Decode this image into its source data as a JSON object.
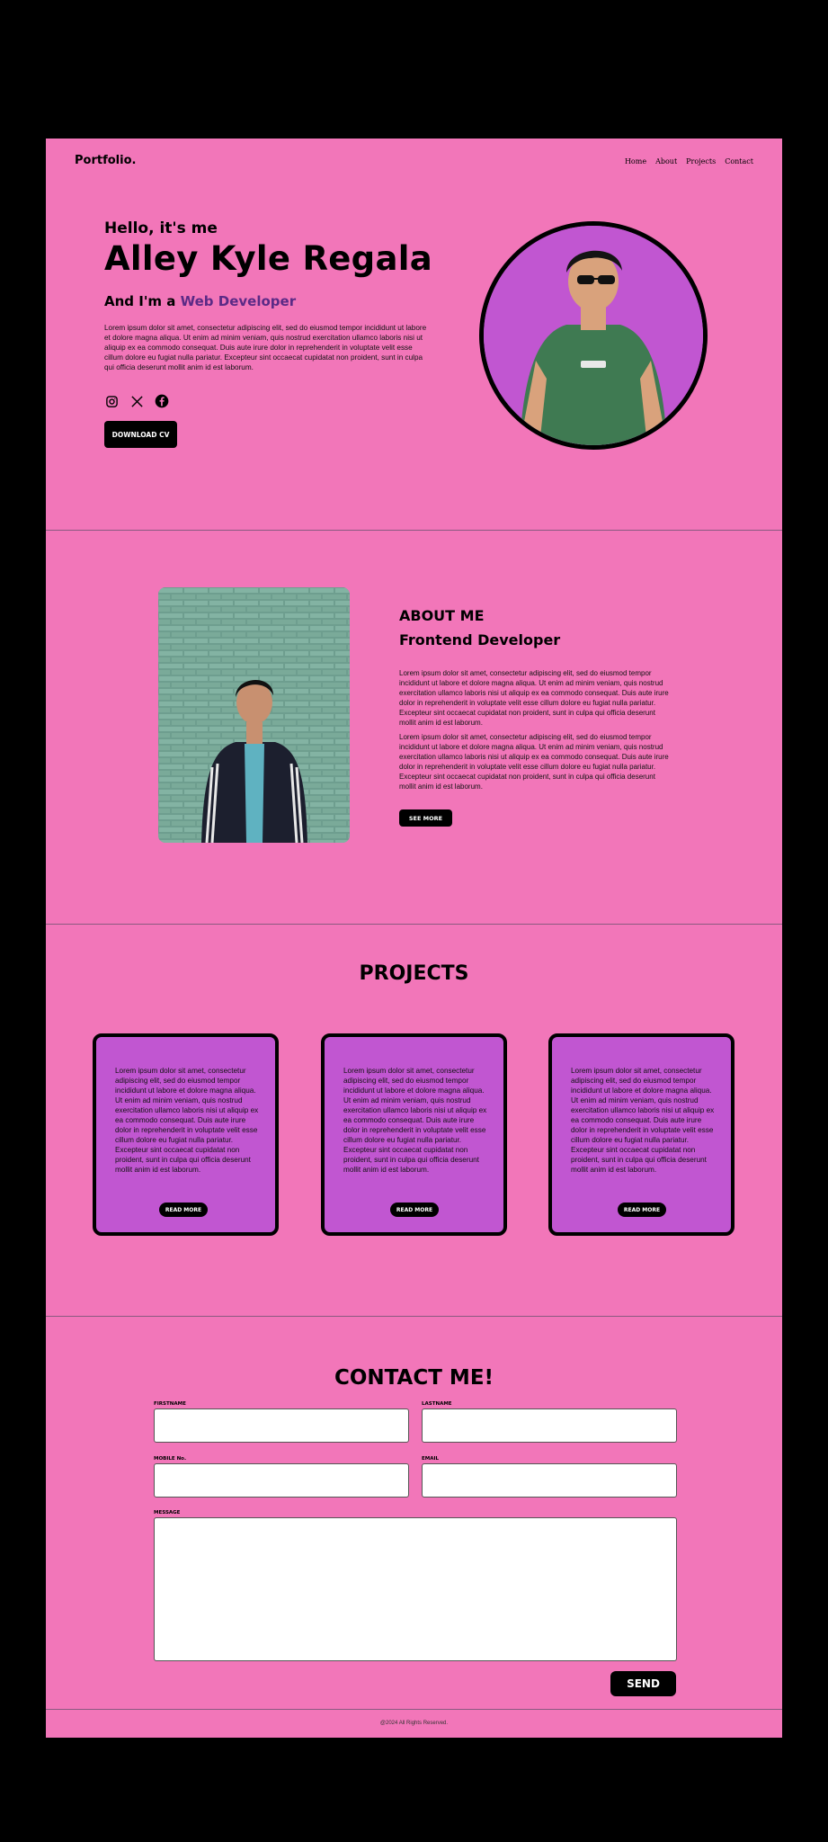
{
  "nav": {
    "logo": "Portfolio.",
    "links": [
      "Home",
      "About",
      "Projects",
      "Contact"
    ]
  },
  "hero": {
    "greeting": "Hello, it's me",
    "name": "Alley Kyle Regala",
    "role_prefix": "And I'm a ",
    "role_highlight": "Web Developer",
    "description": "Lorem ipsum dolor sit amet, consectetur adipiscing elit, sed do eiusmod tempor incididunt ut labore et dolore magna aliqua. Ut enim ad minim veniam, quis nostrud exercitation ullamco laboris nisi ut aliquip ex ea commodo consequat. Duis aute irure dolor in reprehenderit in voluptate velit esse cillum dolore eu fugiat nulla pariatur. Excepteur sint occaecat cupidatat non proident, sunt in culpa qui officia deserunt mollit anim id est laborum.",
    "social_icons": [
      "instagram-icon",
      "x-icon",
      "facebook-icon"
    ],
    "download_label": "DOWNLOAD CV"
  },
  "about": {
    "title": "ABOUT ME",
    "subtitle": "Frontend Developer",
    "paragraph1": "Lorem ipsum dolor sit amet, consectetur adipiscing elit, sed do eiusmod tempor incididunt ut labore et dolore magna aliqua. Ut enim ad minim veniam, quis nostrud exercitation ullamco laboris nisi ut aliquip ex ea commodo consequat. Duis aute irure dolor in reprehenderit in voluptate velit esse cillum dolore eu fugiat nulla pariatur. Excepteur sint occaecat cupidatat non proident, sunt in culpa qui officia deserunt mollit anim id est laborum.",
    "paragraph2": "Lorem ipsum dolor sit amet, consectetur adipiscing elit, sed do eiusmod tempor incididunt ut labore et dolore magna aliqua. Ut enim ad minim veniam, quis nostrud exercitation ullamco laboris nisi ut aliquip ex ea commodo consequat. Duis aute irure dolor in reprehenderit in voluptate velit esse cillum dolore eu fugiat nulla pariatur. Excepteur sint occaecat cupidatat non proident, sunt in culpa qui officia deserunt mollit anim id est laborum.",
    "see_more_label": "SEE MORE"
  },
  "projects": {
    "title": "PROJECTS",
    "cards": [
      {
        "text": "Lorem ipsum dolor sit amet, consectetur adipiscing elit, sed do eiusmod tempor incididunt ut labore et dolore magna aliqua. Ut enim ad minim veniam, quis nostrud exercitation ullamco laboris nisi ut aliquip ex ea commodo consequat. Duis aute irure dolor in reprehenderit in voluptate velit esse cillum dolore eu fugiat nulla pariatur. Excepteur sint occaecat cupidatat non proident, sunt in culpa qui officia deserunt mollit anim id est laborum.",
        "button": "READ MORE"
      },
      {
        "text": "Lorem ipsum dolor sit amet, consectetur adipiscing elit, sed do eiusmod tempor incididunt ut labore et dolore magna aliqua. Ut enim ad minim veniam, quis nostrud exercitation ullamco laboris nisi ut aliquip ex ea commodo consequat. Duis aute irure dolor in reprehenderit in voluptate velit esse cillum dolore eu fugiat nulla pariatur. Excepteur sint occaecat cupidatat non proident, sunt in culpa qui officia deserunt mollit anim id est laborum.",
        "button": "READ MORE"
      },
      {
        "text": "Lorem ipsum dolor sit amet, consectetur adipiscing elit, sed do eiusmod tempor incididunt ut labore et dolore magna aliqua. Ut enim ad minim veniam, quis nostrud exercitation ullamco laboris nisi ut aliquip ex ea commodo consequat. Duis aute irure dolor in reprehenderit in voluptate velit esse cillum dolore eu fugiat nulla pariatur. Excepteur sint occaecat cupidatat non proident, sunt in culpa qui officia deserunt mollit anim id est laborum.",
        "button": "READ MORE"
      }
    ]
  },
  "contact": {
    "title": "CONTACT ME!",
    "firstname_label": "FIRSTNAME",
    "lastname_label": "LASTNAME",
    "mobile_label": "MOBILE No.",
    "email_label": "EMAIL",
    "message_label": "MESSAGE",
    "firstname_value": "",
    "lastname_value": "",
    "mobile_value": "",
    "email_value": "",
    "message_value": "",
    "send_label": "SEND"
  },
  "footer": {
    "text": "@2024 All Rights Reserved."
  },
  "colors": {
    "page_bg": "#f276b9",
    "card_bg": "#c156d1",
    "accent_text": "#5b2a86",
    "outer_bg": "#000000"
  }
}
